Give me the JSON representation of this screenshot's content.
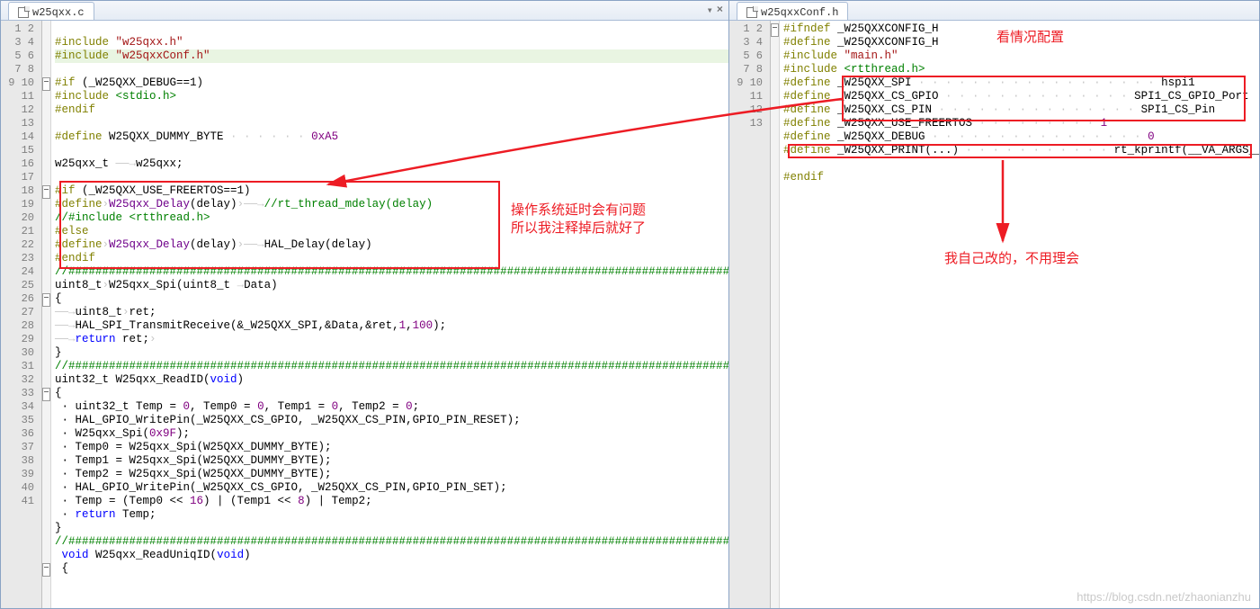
{
  "left": {
    "tab": "w25qxx.c",
    "lines": [
      {
        "n": 1,
        "tokens": []
      },
      {
        "n": 2,
        "tokens": [
          [
            "dir",
            "#include"
          ],
          [
            "txt",
            " "
          ],
          [
            "str",
            "\"w25qxx.h\""
          ]
        ]
      },
      {
        "n": 3,
        "hl": true,
        "tokens": [
          [
            "dir",
            "#include"
          ],
          [
            "txt",
            " "
          ],
          [
            "str",
            "\"w25qxxConf.h\""
          ]
        ]
      },
      {
        "n": 4,
        "tokens": []
      },
      {
        "n": 5,
        "fold": "-",
        "tokens": [
          [
            "dir",
            "#if"
          ],
          [
            "txt",
            " (_W25QXX_DEBUG==1)"
          ]
        ]
      },
      {
        "n": 6,
        "tokens": [
          [
            "dir",
            "#include"
          ],
          [
            "txt",
            " "
          ],
          [
            "cmt",
            "<stdio.h>"
          ]
        ]
      },
      {
        "n": 7,
        "tokens": [
          [
            "dir",
            "#endif"
          ]
        ]
      },
      {
        "n": 8,
        "tokens": []
      },
      {
        "n": 9,
        "tokens": [
          [
            "dir",
            "#define"
          ],
          [
            "txt",
            " "
          ],
          [
            "txt",
            "W25QXX_DUMMY_BYTE"
          ],
          [
            "ws",
            " · · · · · · "
          ],
          [
            "num",
            "0xA5"
          ]
        ]
      },
      {
        "n": 10,
        "tokens": []
      },
      {
        "n": 11,
        "tokens": [
          [
            "txt",
            "w25qxx_t "
          ],
          [
            "ws",
            "——→"
          ],
          [
            "txt",
            "w25qxx;"
          ]
        ]
      },
      {
        "n": 12,
        "tokens": []
      },
      {
        "n": 13,
        "fold": "-",
        "tokens": [
          [
            "dir",
            "#if"
          ],
          [
            "txt",
            " (_W25QXX_USE_FREERTOS==1)"
          ]
        ]
      },
      {
        "n": 14,
        "tokens": [
          [
            "dir",
            "#define"
          ],
          [
            "ws",
            "›"
          ],
          [
            "def",
            "W25qxx_Delay"
          ],
          [
            "txt",
            "(delay)"
          ],
          [
            "ws",
            "›——→"
          ],
          [
            "cmt",
            "//rt_thread_mdelay(delay)"
          ]
        ]
      },
      {
        "n": 15,
        "tokens": [
          [
            "cmt",
            "//#include <rtthread.h>"
          ]
        ]
      },
      {
        "n": 16,
        "tokens": [
          [
            "dir",
            "#else"
          ]
        ]
      },
      {
        "n": 17,
        "tokens": [
          [
            "dir",
            "#define"
          ],
          [
            "ws",
            "›"
          ],
          [
            "def",
            "W25qxx_Delay"
          ],
          [
            "txt",
            "(delay)"
          ],
          [
            "ws",
            "›——→"
          ],
          [
            "txt",
            "HAL_Delay(delay)"
          ]
        ]
      },
      {
        "n": 18,
        "tokens": [
          [
            "dir",
            "#endif"
          ]
        ]
      },
      {
        "n": 19,
        "tokens": [
          [
            "cmt",
            "//###############################################################################################################"
          ]
        ]
      },
      {
        "n": 20,
        "tokens": [
          [
            "txt",
            "uint8_t"
          ],
          [
            "ws",
            "›"
          ],
          [
            "txt",
            "W25qxx_Spi(uint8_t "
          ],
          [
            "ws",
            "→"
          ],
          [
            "txt",
            "Data)"
          ]
        ]
      },
      {
        "n": 21,
        "fold": "-",
        "tokens": [
          [
            "txt",
            "{"
          ]
        ]
      },
      {
        "n": 22,
        "tokens": [
          [
            "ws",
            "——→"
          ],
          [
            "txt",
            "uint8_t"
          ],
          [
            "ws",
            "›"
          ],
          [
            "txt",
            "ret;"
          ]
        ]
      },
      {
        "n": 23,
        "tokens": [
          [
            "ws",
            "——→"
          ],
          [
            "txt",
            "HAL_SPI_TransmitReceive(&_W25QXX_SPI,&Data,&ret,"
          ],
          [
            "num",
            "1"
          ],
          [
            "txt",
            ","
          ],
          [
            "num",
            "100"
          ],
          [
            "txt",
            ");"
          ]
        ]
      },
      {
        "n": 24,
        "tokens": [
          [
            "ws",
            "——→"
          ],
          [
            "kw",
            "return"
          ],
          [
            "txt",
            " ret;"
          ],
          [
            "ws",
            "›"
          ]
        ]
      },
      {
        "n": 25,
        "tokens": [
          [
            "txt",
            "}"
          ]
        ]
      },
      {
        "n": 26,
        "tokens": [
          [
            "cmt",
            "//###############################################################################################################"
          ]
        ]
      },
      {
        "n": 27,
        "tokens": [
          [
            "txt",
            "uint32_t W25qxx_ReadID("
          ],
          [
            "kw",
            "void"
          ],
          [
            "txt",
            ")"
          ]
        ]
      },
      {
        "n": 28,
        "fold": "-",
        "tokens": [
          [
            "txt",
            "{"
          ]
        ]
      },
      {
        "n": 29,
        "tokens": [
          [
            "txt",
            " · uint32_t Temp = "
          ],
          [
            "num",
            "0"
          ],
          [
            "txt",
            ", Temp0 = "
          ],
          [
            "num",
            "0"
          ],
          [
            "txt",
            ", Temp1 = "
          ],
          [
            "num",
            "0"
          ],
          [
            "txt",
            ", Temp2 = "
          ],
          [
            "num",
            "0"
          ],
          [
            "txt",
            ";"
          ]
        ]
      },
      {
        "n": 30,
        "tokens": [
          [
            "txt",
            " · HAL_GPIO_WritePin(_W25QXX_CS_GPIO, _W25QXX_CS_PIN,GPIO_PIN_RESET);"
          ]
        ]
      },
      {
        "n": 31,
        "tokens": [
          [
            "txt",
            " · W25qxx_Spi("
          ],
          [
            "num",
            "0x9F"
          ],
          [
            "txt",
            ");"
          ]
        ]
      },
      {
        "n": 32,
        "tokens": [
          [
            "txt",
            " · Temp0 = W25qxx_Spi(W25QXX_DUMMY_BYTE);"
          ]
        ]
      },
      {
        "n": 33,
        "tokens": [
          [
            "txt",
            " · Temp1 = W25qxx_Spi(W25QXX_DUMMY_BYTE);"
          ]
        ]
      },
      {
        "n": 34,
        "tokens": [
          [
            "txt",
            " · Temp2 = W25qxx_Spi(W25QXX_DUMMY_BYTE);"
          ]
        ]
      },
      {
        "n": 35,
        "tokens": [
          [
            "txt",
            " · HAL_GPIO_WritePin(_W25QXX_CS_GPIO, _W25QXX_CS_PIN,GPIO_PIN_SET);"
          ]
        ]
      },
      {
        "n": 36,
        "tokens": [
          [
            "txt",
            " · Temp = (Temp0 << "
          ],
          [
            "num",
            "16"
          ],
          [
            "txt",
            ") | (Temp1 << "
          ],
          [
            "num",
            "8"
          ],
          [
            "txt",
            ") | Temp2;"
          ]
        ]
      },
      {
        "n": 37,
        "tokens": [
          [
            "txt",
            " · "
          ],
          [
            "kw",
            "return"
          ],
          [
            "txt",
            " Temp;"
          ]
        ]
      },
      {
        "n": 38,
        "tokens": [
          [
            "txt",
            "}"
          ]
        ]
      },
      {
        "n": 39,
        "tokens": [
          [
            "cmt",
            "//###############################################################################################################"
          ]
        ]
      },
      {
        "n": 40,
        "tokens": [
          [
            "txt",
            " "
          ],
          [
            "kw",
            "void"
          ],
          [
            "txt",
            " W25qxx_ReadUniqID("
          ],
          [
            "kw",
            "void"
          ],
          [
            "txt",
            ")"
          ]
        ]
      },
      {
        "n": 41,
        "fold": "-",
        "tokens": [
          [
            "txt",
            " {"
          ]
        ]
      }
    ]
  },
  "right": {
    "tab": "w25qxxConf.h",
    "lines": [
      {
        "n": 1,
        "fold": "-",
        "tokens": [
          [
            "dir",
            "#ifndef"
          ],
          [
            "txt",
            " _W25QXXCONFIG_H"
          ]
        ]
      },
      {
        "n": 2,
        "tokens": [
          [
            "dir",
            "#define"
          ],
          [
            "txt",
            " _W25QXXCONFIG_H"
          ]
        ]
      },
      {
        "n": 3,
        "tokens": [
          [
            "dir",
            "#include"
          ],
          [
            "txt",
            " "
          ],
          [
            "str",
            "\"main.h\""
          ]
        ]
      },
      {
        "n": 4,
        "tokens": [
          [
            "dir",
            "#include"
          ],
          [
            "txt",
            " "
          ],
          [
            "cmt",
            "<rtthread.h>"
          ]
        ]
      },
      {
        "n": 5,
        "tokens": [
          [
            "dir",
            "#define"
          ],
          [
            "txt",
            " _W25QXX_SPI"
          ],
          [
            "ws",
            " · · · · · · · · · · · · · · · · · · "
          ],
          [
            "txt",
            "hspi1"
          ]
        ]
      },
      {
        "n": 6,
        "tokens": [
          [
            "dir",
            "#define"
          ],
          [
            "txt",
            " _W25QXX_CS_GPIO"
          ],
          [
            "ws",
            " · · · · · · · · · · · · · · "
          ],
          [
            "txt",
            "SPI1_CS_GPIO_Port"
          ]
        ]
      },
      {
        "n": 7,
        "tokens": [
          [
            "dir",
            "#define"
          ],
          [
            "txt",
            " _W25QXX_CS_PIN"
          ],
          [
            "ws",
            " · · · · · · · · · · · · · · · "
          ],
          [
            "txt",
            "SPI1_CS_Pin"
          ]
        ]
      },
      {
        "n": 8,
        "tokens": [
          [
            "dir",
            "#define"
          ],
          [
            "txt",
            " _W25QXX_USE_FREERTOS"
          ],
          [
            "ws",
            " · · · · · · · · · "
          ],
          [
            "num",
            "1"
          ]
        ]
      },
      {
        "n": 9,
        "tokens": [
          [
            "dir",
            "#define"
          ],
          [
            "txt",
            " _W25QXX_DEBUG"
          ],
          [
            "ws",
            " · · · · · · · · · · · · · · · · "
          ],
          [
            "num",
            "0"
          ]
        ]
      },
      {
        "n": 10,
        "tokens": [
          [
            "dir",
            "#define"
          ],
          [
            "txt",
            " _W25QXX_PRINT(...)"
          ],
          [
            "ws",
            " · · · · · · · · · · · "
          ],
          [
            "txt",
            "rt_kprintf(__VA_ARGS__)"
          ]
        ]
      },
      {
        "n": 11,
        "tokens": []
      },
      {
        "n": 12,
        "tokens": [
          [
            "dir",
            "#endif"
          ]
        ]
      },
      {
        "n": 13,
        "tokens": []
      }
    ]
  },
  "annotations": {
    "left_note": "操作系统延时会有问题\n所以我注释掉后就好了",
    "right_top": "看情况配置",
    "right_bottom": "我自己改的，不用理会"
  },
  "watermark": "https://blog.csdn.net/zhaonianzhu"
}
